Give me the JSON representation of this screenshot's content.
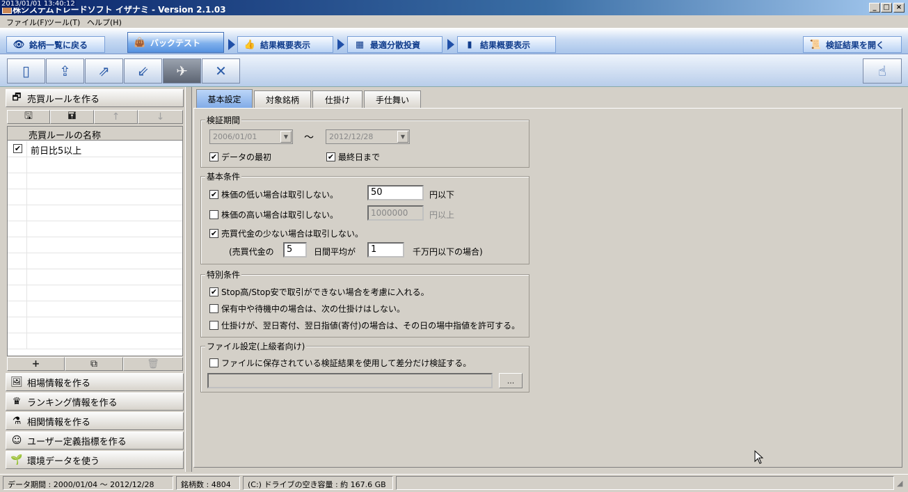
{
  "window": {
    "timestamp": "2013/01/01 13:40:12",
    "title": "株システムトレードソフト イザナミ - Version 2.1.03",
    "minimize": "_",
    "maximize": "□",
    "close": "×"
  },
  "menu": [
    "ファイル(F)",
    "ツール(T)",
    "ヘルプ(H)"
  ],
  "nav": {
    "back": "銘柄一覧に戻る",
    "tabs": [
      "バックテスト",
      "結果概要表示",
      "最適分散投資",
      "結果概要表示"
    ],
    "open_results": "検証結果を開く"
  },
  "left": {
    "sections": {
      "rules": "売買ルールを作る",
      "market": "相場情報を作る",
      "ranking": "ランキング情報を作る",
      "correlation": "相関情報を作る",
      "user_indicator": "ユーザー定義指標を作る",
      "environment": "環境データを使う"
    },
    "grid_header": "売買ルールの名称",
    "rules": [
      {
        "checked": "✔",
        "name": "前日比5以上"
      }
    ]
  },
  "tabs": [
    "基本設定",
    "対象銘柄",
    "仕掛け",
    "手仕舞い"
  ],
  "period": {
    "legend": "検証期間",
    "start": "2006/01/01",
    "tilde": "〜",
    "end": "2012/12/28",
    "from_first": "データの最初",
    "to_last": "最終日まで",
    "check": "✔"
  },
  "basic": {
    "legend": "基本条件",
    "low_price": {
      "label": "株価の低い場合は取引しない。",
      "value": "50",
      "unit": "円以下",
      "check": "✔"
    },
    "high_price": {
      "label": "株価の高い場合は取引しない。",
      "value": "1000000",
      "unit": "円以上"
    },
    "low_volume": {
      "label": "売買代金の少ない場合は取引しない。",
      "check": "✔"
    },
    "vol_detail": {
      "prefix": "(売買代金の",
      "days": "5",
      "mid": "日間平均が",
      "amount": "1",
      "suffix": "千万円以下の場合)"
    }
  },
  "special": {
    "legend": "特別条件",
    "opt1": "Stop高/Stop安で取引ができない場合を考慮に入れる。",
    "opt1_check": "✔",
    "opt2": "保有中や待機中の場合は、次の仕掛けはしない。",
    "opt3": "仕掛けが、翌日寄付、翌日指値(寄付)の場合は、その日の場中指値を許可する。"
  },
  "file": {
    "legend": "ファイル設定(上級者向け)",
    "opt": "ファイルに保存されている検証結果を使用して差分だけ検証する。",
    "browse": "..."
  },
  "status": {
    "period": "データ期間 : 2000/01/04 〜 2012/12/28",
    "count": "銘柄数 : 4804",
    "disk": "(C:) ドライブの空き容量 : 約 167.6 GB"
  }
}
